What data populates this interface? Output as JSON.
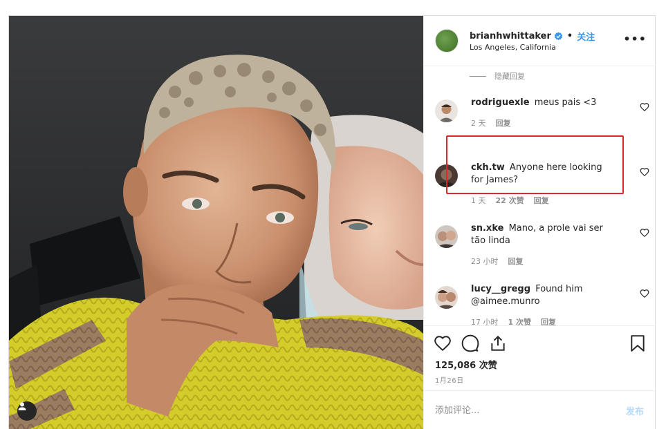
{
  "post": {
    "username": "brianhwhittaker",
    "separator": "•",
    "follow_label": "关注",
    "location": "Los Angeles, California",
    "more_label": "•••"
  },
  "comments": {
    "hide_replies_label": "隐藏回复",
    "items": [
      {
        "user": "rodriguexle",
        "text": "meus pais <3",
        "time": "2 天",
        "likes": "",
        "reply": "回复"
      },
      {
        "user": "ckh.tw",
        "text": "Anyone here looking for James?",
        "time": "1 天",
        "likes": "22 次赞",
        "reply": "回复"
      },
      {
        "user": "sn.xke",
        "text": "Mano, a prole vai ser tão linda",
        "time": "23 小时",
        "likes": "",
        "reply": "回复"
      },
      {
        "user": "lucy__gregg",
        "text": "Found him @aimee.munro",
        "time": "17 小时",
        "likes": "1 次赞",
        "reply": "回复"
      }
    ]
  },
  "actions": {
    "likes_count": "125,086 次赞",
    "date": "1月26日"
  },
  "composer": {
    "placeholder": "添加评论...",
    "post_label": "发布"
  },
  "colors": {
    "accent": "#3897f0",
    "highlight": "#e0262b",
    "muted": "#8e8e8e"
  }
}
